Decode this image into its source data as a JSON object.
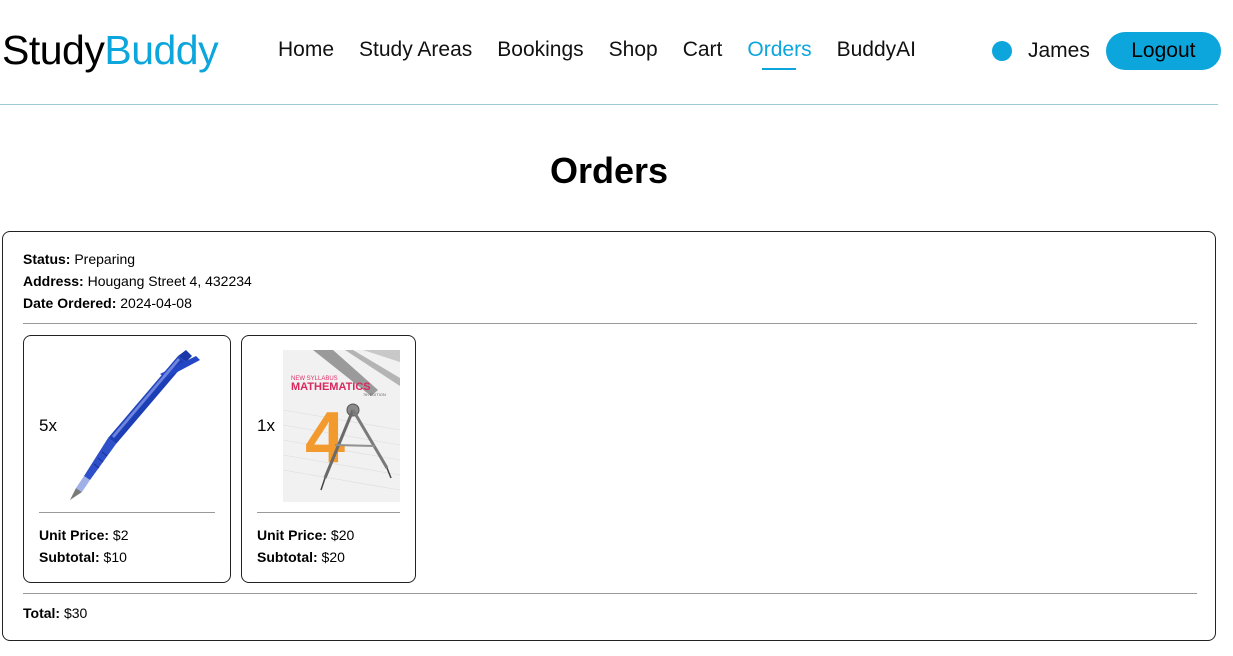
{
  "brand": {
    "part1": "Study",
    "part2": "Buddy"
  },
  "nav": {
    "items": [
      {
        "label": "Home"
      },
      {
        "label": "Study Areas"
      },
      {
        "label": "Bookings"
      },
      {
        "label": "Shop"
      },
      {
        "label": "Cart"
      },
      {
        "label": "Orders",
        "active": true
      },
      {
        "label": "BuddyAI"
      }
    ]
  },
  "user": {
    "name": "James",
    "logout_label": "Logout"
  },
  "page": {
    "title": "Orders"
  },
  "order": {
    "status_label": "Status:",
    "status": "Preparing",
    "address_label": "Address:",
    "address": "Hougang Street 4, 432234",
    "date_label": "Date Ordered:",
    "date": "2024-04-08",
    "items": [
      {
        "qty": "5x",
        "image_icon": "blue-gel-pen",
        "unit_price_label": "Unit Price:",
        "unit_price": "$2",
        "subtotal_label": "Subtotal:",
        "subtotal": "$10"
      },
      {
        "qty": "1x",
        "image_icon": "mathematics-textbook",
        "book_line1": "NEW SYLLABUS",
        "book_line2": "MATHEMATICS",
        "book_line3": "7th EDITION",
        "book_number": "4",
        "unit_price_label": "Unit Price:",
        "unit_price": "$20",
        "subtotal_label": "Subtotal:",
        "subtotal": "$20"
      }
    ],
    "total_label": "Total:",
    "total": "$30"
  },
  "colors": {
    "accent": "#0da6dc",
    "divider": "#9cc9d3"
  }
}
